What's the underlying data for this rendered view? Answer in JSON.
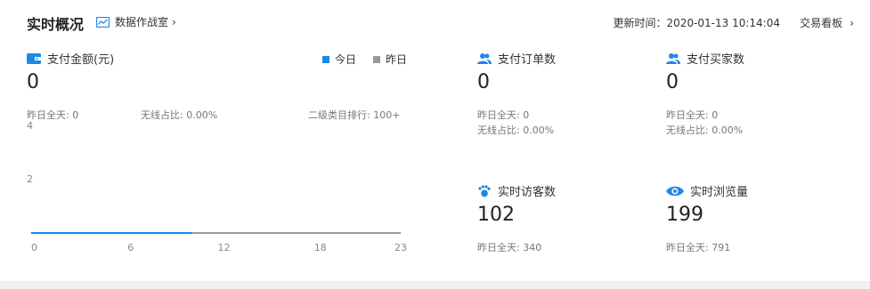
{
  "header": {
    "title": "实时概况",
    "data_room_link": "数据作战室",
    "update_time": "更新时间：2020-01-13 10:14:04",
    "board_link": "交易看板"
  },
  "payment": {
    "title": "支付金额(元)",
    "value": "0",
    "legend_today": "今日",
    "legend_yesterday": "昨日",
    "yesterday_full": "昨日全天: 0",
    "wireless_ratio": "无线占比: 0.00%",
    "category_rank": "二级类目排行: 100+"
  },
  "metrics": [
    {
      "title": "支付订单数",
      "icon": "users-icon",
      "value": "0",
      "sub1": "昨日全天: 0",
      "sub2": "无线占比: 0.00%"
    },
    {
      "title": "支付买家数",
      "icon": "users-icon",
      "value": "0",
      "sub1": "昨日全天: 0",
      "sub2": "无线占比: 0.00%"
    },
    {
      "title": "实时访客数",
      "icon": "footprint-icon",
      "value": "102",
      "sub1": "昨日全天: 340"
    },
    {
      "title": "实时浏览量",
      "icon": "eye-icon",
      "value": "199",
      "sub1": "昨日全天: 791"
    }
  ],
  "colors": {
    "accent": "#1e88e5",
    "today": "#1e88e5",
    "yesterday": "#999999"
  },
  "chart_data": {
    "type": "line",
    "x_ticks": [
      "0",
      "6",
      "12",
      "18",
      "23"
    ],
    "y_ticks": [
      "2",
      "4"
    ],
    "xlim": [
      0,
      23
    ],
    "ylim": [
      0,
      5
    ],
    "series": [
      {
        "name": "今日",
        "x": [
          0,
          1,
          2,
          3,
          4,
          5,
          6,
          7,
          8,
          9,
          10
        ],
        "values": [
          0,
          0,
          0,
          0,
          0,
          0,
          0,
          0,
          0,
          0,
          0
        ]
      },
      {
        "name": "昨日",
        "x": [
          0,
          1,
          2,
          3,
          4,
          5,
          6,
          7,
          8,
          9,
          10,
          11,
          12,
          13,
          14,
          15,
          16,
          17,
          18,
          19,
          20,
          21,
          22,
          23
        ],
        "values": [
          0,
          0,
          0,
          0,
          0,
          0,
          0,
          0,
          0,
          0,
          0,
          0,
          0,
          0,
          0,
          0,
          0,
          0,
          0,
          0,
          0,
          0,
          0,
          0
        ]
      }
    ]
  }
}
